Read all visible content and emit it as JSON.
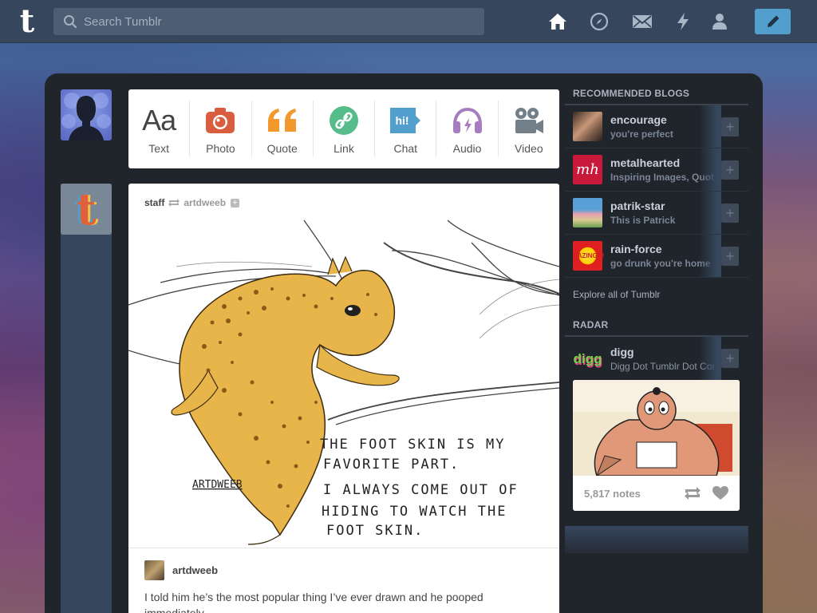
{
  "search": {
    "placeholder": "Search Tumblr"
  },
  "nav": {
    "logo": "t",
    "icons": [
      "home-icon",
      "explore-compass-icon",
      "inbox-mail-icon",
      "activity-lightning-icon",
      "account-person-icon"
    ],
    "compose_icon": "pencil-icon"
  },
  "post_types": [
    {
      "label": "Text",
      "glyph": "Aa",
      "color": "#444444"
    },
    {
      "label": "Photo",
      "color": "#d95e40"
    },
    {
      "label": "Quote",
      "glyph": "“",
      "color": "#f2992e"
    },
    {
      "label": "Link",
      "color": "#56bc8a"
    },
    {
      "label": "Chat",
      "glyph": "hi!",
      "color": "#529ecc"
    },
    {
      "label": "Audio",
      "color": "#a77dc2"
    },
    {
      "label": "Video",
      "color": "#748089"
    }
  ],
  "post": {
    "blog": "staff",
    "reblogged_from": "artdweeb",
    "image_text_line1": "THE FOOT SKIN IS MY",
    "image_text_line2": "FAVORITE PART.",
    "image_text_line3": "I ALWAYS COME OUT OF",
    "image_text_line4": "HIDING TO WATCH THE",
    "image_text_line5": "FOOT SKIN.",
    "image_signature": "ARTDWEEB",
    "author": "artdweeb",
    "body": "I told him he’s the most popular thing I’ve ever drawn and he pooped immediately."
  },
  "sidebar": {
    "recommended_title": "RECOMMENDED BLOGS",
    "blogs": [
      {
        "name": "encourage",
        "subtitle": "you're perfect"
      },
      {
        "name": "metalhearted",
        "subtitle": "Inspiring Images, Quotes",
        "avatar_text": "mh"
      },
      {
        "name": "patrik-star",
        "subtitle": "This is Patrick"
      },
      {
        "name": "rain-force",
        "subtitle": "go drunk you're home",
        "avatar_text": "BAZINGA!"
      }
    ],
    "explore": "Explore all of Tumblr",
    "radar_title": "RADAR",
    "radar_blog": {
      "name": "digg",
      "subtitle": "Digg Dot Tumblr Dot Com",
      "avatar_text": "digg"
    },
    "radar_notes": "5,817 notes"
  },
  "colors": {
    "topbar": "#36465d",
    "accent": "#529ecc",
    "frame": "#20252c"
  }
}
